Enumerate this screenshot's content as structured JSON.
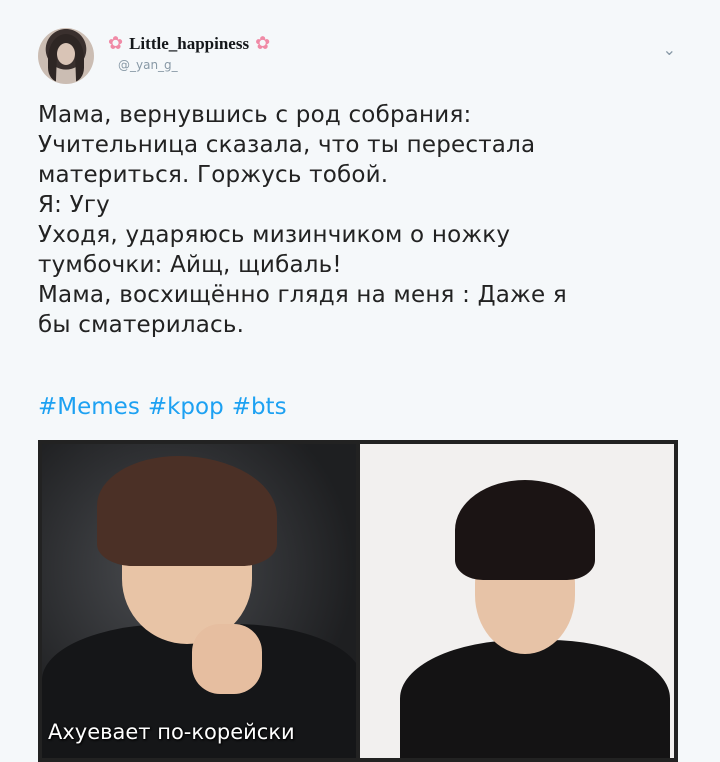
{
  "tweet": {
    "display_name": "Little_happiness",
    "handle": "@_yan_g_",
    "lines": [
      "Мама, вернувшись с род собрания:",
      "Учительница сказала, что ты перестала",
      "материться. Горжусь тобой.",
      "Я: Угу",
      "Уходя, ударяюсь мизинчиком о ножку",
      "тумбочки: Айщ, щибаль!",
      "Мама, восхищённо глядя на меня : Даже я",
      "бы сматерилась."
    ],
    "hashtags": [
      "#Memes",
      "#kpop",
      "#bts"
    ]
  },
  "media": {
    "caption": "Ахуевает по-корейски"
  },
  "icons": {
    "flower": "flower-icon",
    "chevron": "chevron-down-icon"
  },
  "colors": {
    "link": "#1da1f2",
    "flower": "#f08aa6"
  }
}
